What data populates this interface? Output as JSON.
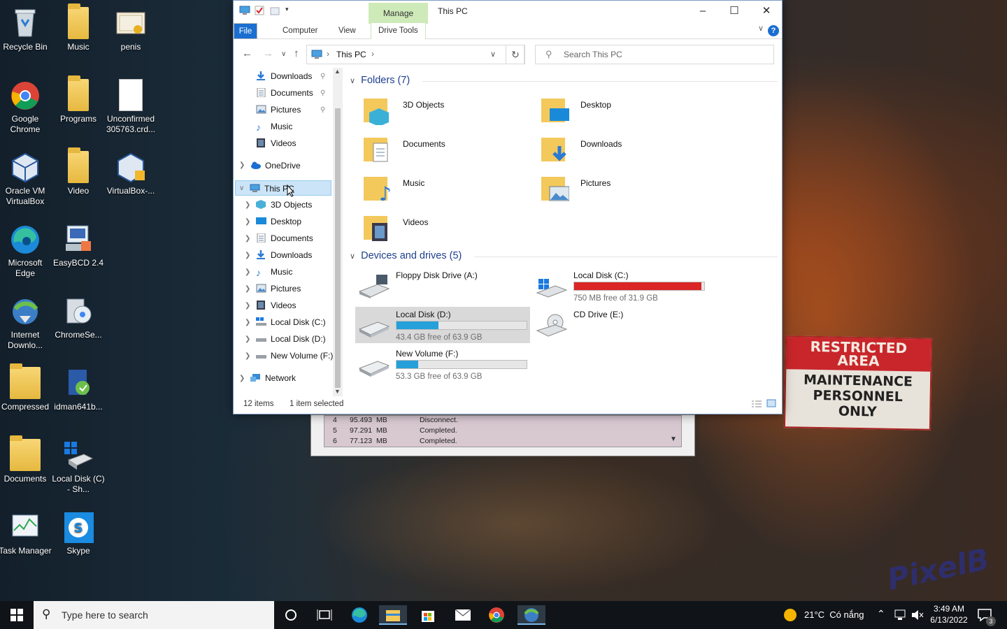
{
  "desktop": {
    "icons": [
      {
        "label": "Recycle Bin",
        "icon": "recycle-bin-icon"
      },
      {
        "label": "Music",
        "icon": "folder-icon"
      },
      {
        "label": "penis",
        "icon": "certificate-icon"
      },
      {
        "label": "Google Chrome",
        "icon": "chrome-icon"
      },
      {
        "label": "Programs",
        "icon": "folder-icon"
      },
      {
        "label": "Unconfirmed 305763.crd...",
        "icon": "file-icon"
      },
      {
        "label": "Oracle VM VirtualBox",
        "icon": "virtualbox-icon"
      },
      {
        "label": "Video",
        "icon": "folder-icon"
      },
      {
        "label": "VirtualBox-...",
        "icon": "virtualbox-installer-icon"
      },
      {
        "label": "Microsoft Edge",
        "icon": "edge-icon"
      },
      {
        "label": "EasyBCD 2.4",
        "icon": "easybcd-icon"
      },
      {
        "label": "Internet Downlo...",
        "icon": "idm-icon"
      },
      {
        "label": "ChromeSe...",
        "icon": "chromesetup-icon"
      },
      {
        "label": "Compressed",
        "icon": "folder-icon"
      },
      {
        "label": "idman641b...",
        "icon": "idm-installer-icon"
      },
      {
        "label": "Documents",
        "icon": "folder-icon"
      },
      {
        "label": "Local Disk (C) - Sh...",
        "icon": "drive-shortcut-icon"
      },
      {
        "label": "Task Manager",
        "icon": "task-manager-icon"
      },
      {
        "label": "Skype",
        "icon": "skype-icon"
      }
    ],
    "sign": {
      "line1": "RESTRICTED",
      "line2": "AREA",
      "line3": "MAINTENANCE",
      "line4": "PERSONNEL",
      "line5": "ONLY"
    },
    "watermark": "PixelB"
  },
  "window": {
    "title": "This PC",
    "manage_tab": "Manage",
    "tabs": {
      "file": "File",
      "computer": "Computer",
      "view": "View",
      "drive_tools": "Drive Tools"
    },
    "help": "?",
    "address": {
      "location": "This PC"
    },
    "search": {
      "placeholder": "Search This PC"
    },
    "sidebar": {
      "quick": [
        {
          "label": "Downloads",
          "icon": "download-arrow-icon"
        },
        {
          "label": "Documents",
          "icon": "document-icon"
        },
        {
          "label": "Pictures",
          "icon": "pictures-icon"
        },
        {
          "label": "Music",
          "icon": "music-note-icon"
        },
        {
          "label": "Videos",
          "icon": "video-icon"
        }
      ],
      "onedrive": "OneDrive",
      "thispc": "This PC",
      "thispc_children": [
        {
          "label": "3D Objects",
          "icon": "cube-icon"
        },
        {
          "label": "Desktop",
          "icon": "desktop-icon"
        },
        {
          "label": "Documents",
          "icon": "document-icon"
        },
        {
          "label": "Downloads",
          "icon": "download-arrow-icon"
        },
        {
          "label": "Music",
          "icon": "music-note-icon"
        },
        {
          "label": "Pictures",
          "icon": "pictures-icon"
        },
        {
          "label": "Videos",
          "icon": "video-icon"
        },
        {
          "label": "Local Disk (C:)",
          "icon": "windows-drive-icon"
        },
        {
          "label": "Local Disk (D:)",
          "icon": "drive-icon"
        },
        {
          "label": "New Volume (F:)",
          "icon": "drive-icon"
        }
      ],
      "network": "Network"
    },
    "folders_header": "Folders (7)",
    "folders": [
      {
        "label": "3D Objects",
        "icon": "cube-icon"
      },
      {
        "label": "Desktop",
        "icon": "desktop-icon"
      },
      {
        "label": "Documents",
        "icon": "document-icon"
      },
      {
        "label": "Downloads",
        "icon": "download-arrow-icon"
      },
      {
        "label": "Music",
        "icon": "music-note-icon"
      },
      {
        "label": "Pictures",
        "icon": "pictures-icon"
      },
      {
        "label": "Videos",
        "icon": "video-icon"
      }
    ],
    "drives_header": "Devices and drives (5)",
    "drives": [
      {
        "name": "Floppy Disk Drive (A:)",
        "free": "",
        "used_pct": null,
        "color": ""
      },
      {
        "name": "Local Disk (C:)",
        "free": "750 MB free of 31.9 GB",
        "used_pct": 97.7,
        "color": "#da2626"
      },
      {
        "name": "Local Disk (D:)",
        "free": "43.4 GB free of 63.9 GB",
        "used_pct": 32.1,
        "color": "#26a0da"
      },
      {
        "name": "CD Drive (E:)",
        "free": "",
        "used_pct": null,
        "color": ""
      },
      {
        "name": "New Volume (F:)",
        "free": "53.3 GB free of 63.9 GB",
        "used_pct": 16.6,
        "color": "#26a0da"
      }
    ],
    "status": {
      "items": "12 items",
      "selected": "1 item selected"
    }
  },
  "background_dialog": {
    "rows": [
      {
        "num": "4",
        "size": "95.493  MB",
        "status": "Disconnect."
      },
      {
        "num": "5",
        "size": "97.291  MB",
        "status": "Completed."
      },
      {
        "num": "6",
        "size": "77.123  MB",
        "status": "Completed."
      }
    ]
  },
  "taskbar": {
    "search_placeholder": "Type here to search",
    "weather": "21°C  Có nắng",
    "time": "3:49 AM",
    "date": "6/13/2022",
    "notif_count": "3"
  },
  "colors": {
    "accent": "#1a6fd0",
    "selection": "#cce4f7",
    "manage_tab": "#cfeab9",
    "disk_full": "#da2626",
    "disk_normal": "#26a0da"
  }
}
